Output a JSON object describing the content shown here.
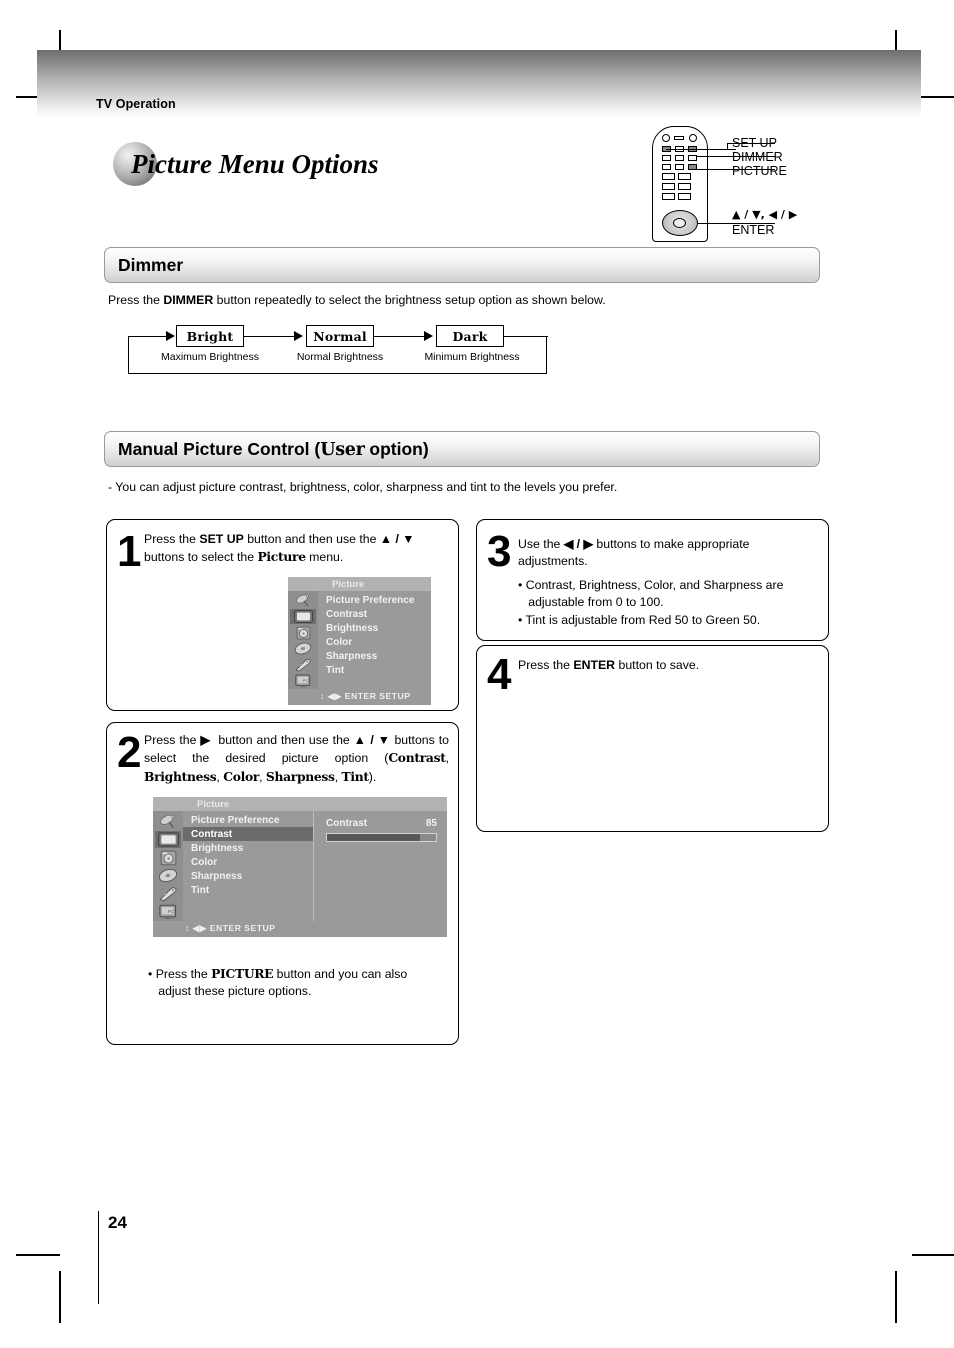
{
  "header": {
    "running_head": "TV Operation",
    "chapter_title": "Picture Menu Options"
  },
  "remote": {
    "labels": [
      {
        "id": "set-up",
        "text": "SET UP"
      },
      {
        "id": "dimmer",
        "text": "DIMMER"
      },
      {
        "id": "picture",
        "text": "PICTURE"
      }
    ],
    "dpad_label_line1": "▲ / ▼, ◀ / ▶",
    "dpad_label_line2": "ENTER"
  },
  "dimmer": {
    "heading": "Dimmer",
    "intro_prefix": "Press the ",
    "intro_bold": "DIMMER",
    "intro_suffix": " button repeatedly to select the brightness setup option as shown below.",
    "flow": [
      {
        "label": "Bright",
        "caption": "Maximum Brightness"
      },
      {
        "label": "Normal",
        "caption": "Normal Brightness"
      },
      {
        "label": "Dark",
        "caption": "Minimum Brightness"
      }
    ]
  },
  "manual": {
    "heading_prefix": "Manual Picture Control (",
    "heading_slab": "User",
    "heading_suffix": " option)",
    "note": "-  You can adjust picture contrast, brightness, color, sharpness and tint to the levels you prefer."
  },
  "steps": [
    {
      "number": "1",
      "text_html": "Press the <b>SET UP</b> button and then use the <b>▲ / ▼</b> buttons to select the <b class=\"slab\">Picture</b> menu."
    },
    {
      "number": "2",
      "text_html": "Press the <b>▶</b>&nbsp; button and then use the <b>▲ / ▼</b> buttons to select the desired picture option (<b class=\"slab\">Contrast</b>, <b class=\"slab\">Brightness</b>, <b class=\"slab\">Color</b>, <b class=\"slab\">Sharpness</b>, <b class=\"slab\">Tint</b>).",
      "note_html": "• Press the <b class=\"slab\">PICTURE</b> button and you can also<br>&nbsp;&nbsp; adjust these picture options."
    },
    {
      "number": "3",
      "text_html": "Use the <b>◀ / ▶</b> buttons to make appropriate adjustments.",
      "bullets": [
        "• Contrast, Brightness, Color, and Sharpness are",
        "   adjustable from 0 to 100.",
        "• Tint is adjustable from Red 50 to Green 50."
      ]
    },
    {
      "number": "4",
      "text_html": "Press the <b>ENTER</b> button to save."
    }
  ],
  "osd1": {
    "title": "Picture",
    "items": [
      "Picture Preference",
      "Contrast",
      "Brightness",
      "Color",
      "Sharpness",
      "Tint"
    ],
    "highlight_index": -1,
    "footer": "↕ ◀▶ ENTER  SETUP",
    "icons": [
      "satellite-dish",
      "tv-screen",
      "disc-player",
      "disc",
      "remote",
      "pc-monitor"
    ],
    "selected_icon_index": 1
  },
  "osd2": {
    "title": "Picture",
    "items": [
      "Picture Preference",
      "Contrast",
      "Brightness",
      "Color",
      "Sharpness",
      "Tint"
    ],
    "highlight_index": 1,
    "footer": "↕ ◀▶ ENTER  SETUP",
    "icons": [
      "satellite-dish",
      "tv-screen",
      "disc-player",
      "disc",
      "remote",
      "pc-monitor"
    ],
    "selected_icon_index": 1,
    "detail": {
      "label": "Contrast",
      "value": "85",
      "percent": 85
    }
  },
  "footer": {
    "page_number": "24"
  },
  "colors": {
    "osd_bg": "#9a9a9a",
    "osd_title_bg": "#b2b2b2",
    "osd_highlight": "#6b6b6b",
    "osd_bar_fill": "#585858",
    "band_border": "#9a9a9a"
  }
}
